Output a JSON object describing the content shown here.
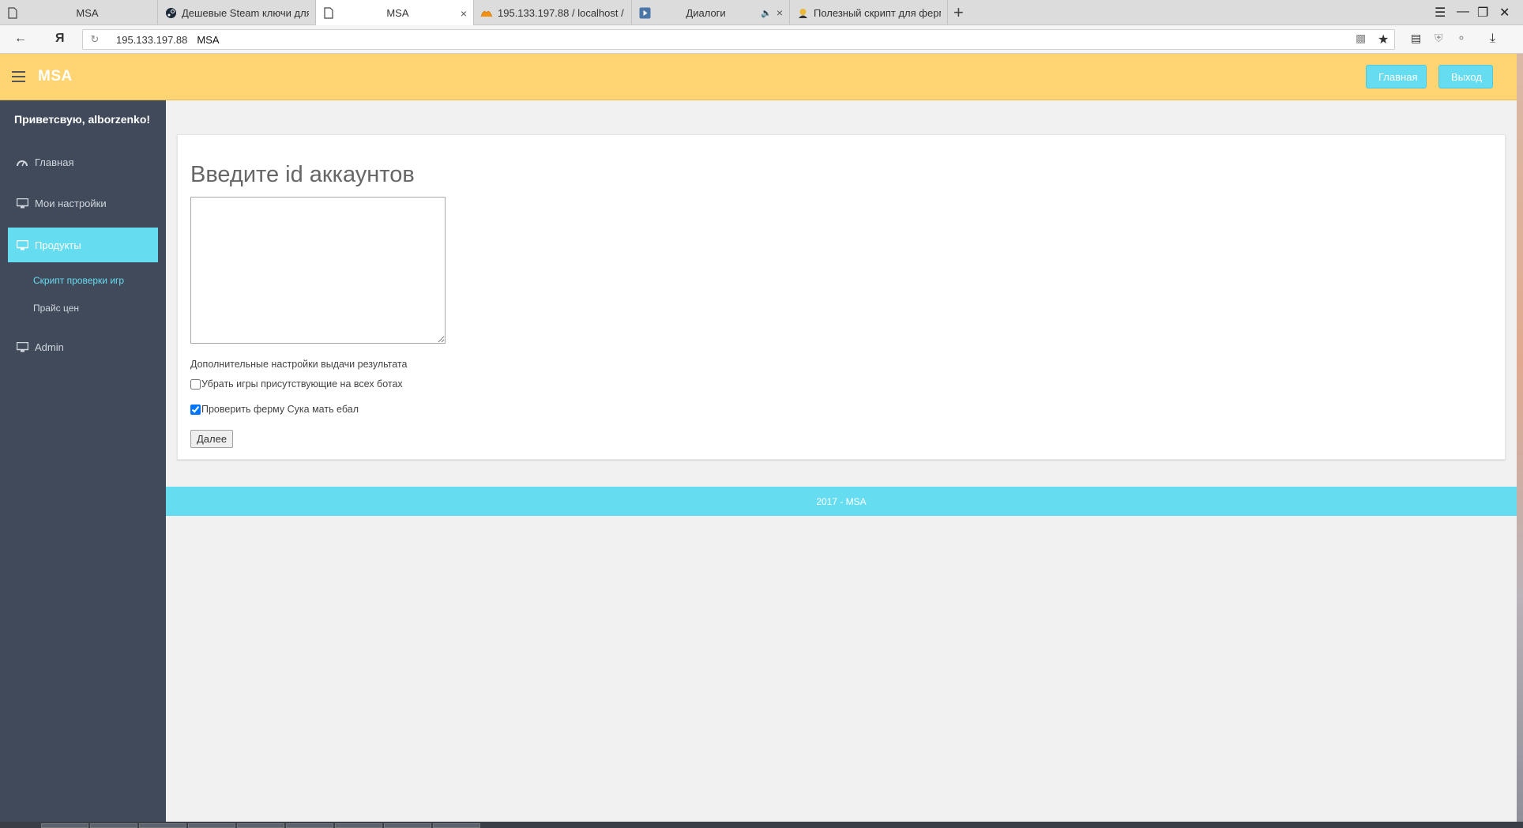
{
  "browser": {
    "tabs": [
      {
        "title": "MSA",
        "icon": "page-icon"
      },
      {
        "title": "Дешевые Steam ключи для",
        "icon": "steam-icon"
      },
      {
        "title": "MSA",
        "icon": "page-icon",
        "close": "×"
      },
      {
        "title": "195.133.197.88 / localhost /",
        "icon": "phpmyadmin-icon"
      },
      {
        "title": "Диалоги",
        "icon": "video-icon",
        "close": "×"
      },
      {
        "title": "Полезный скрипт для ферм",
        "icon": "forum-icon"
      }
    ],
    "new_tab": "+",
    "yandex_logo": "Я",
    "address": {
      "url": "195.133.197.88",
      "site_title": "MSA"
    }
  },
  "header": {
    "brand": "MSA",
    "home_button": "Главная",
    "logout_button": "Выход"
  },
  "sidebar": {
    "greeting": "Приветсвую, alborzenko!",
    "items": [
      {
        "label": "Главная",
        "icon": "dashboard-icon"
      },
      {
        "label": "Мои настройки",
        "icon": "monitor-icon"
      },
      {
        "label": "Продукты",
        "icon": "monitor-icon",
        "active": true
      },
      {
        "label": "Admin",
        "icon": "monitor-icon"
      }
    ],
    "sub_items": [
      {
        "label": "Скрипт проверки игр",
        "active": true
      },
      {
        "label": "Прайс цен"
      }
    ]
  },
  "main": {
    "title": "Введите id аккаунтов",
    "textarea_value": "",
    "options_label": "Дополнительные настройки выдачи результата",
    "checkboxes": [
      {
        "label": "Убрать игры присутствующие на всех ботах",
        "checked": false
      },
      {
        "label": "Проверить ферму Сука мать ебал",
        "checked": true
      }
    ],
    "next_button": "Далее"
  },
  "footer": {
    "text": "2017 - MSA"
  },
  "colors": {
    "header_bg": "#ffd472",
    "accent": "#65dcf0",
    "sidebar_bg": "#414a5a",
    "content_bg": "#f1f1f1"
  }
}
